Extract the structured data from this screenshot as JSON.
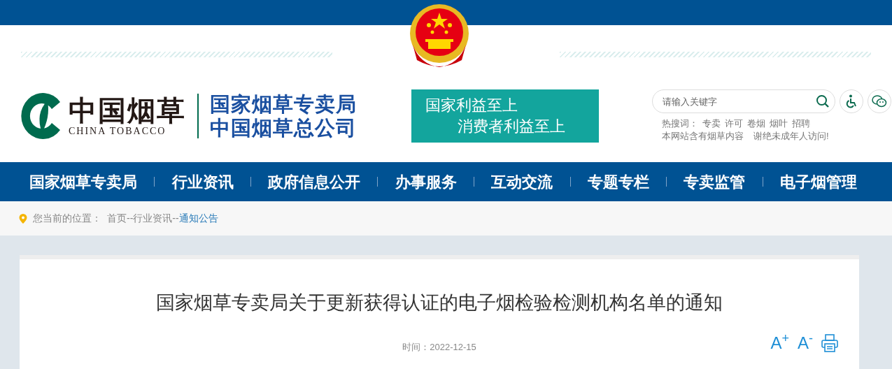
{
  "logo": {
    "name": "中国烟草",
    "subtitle": "CHINA TOBACCO"
  },
  "agency": [
    "国家烟草专卖局",
    "中国烟草总公司"
  ],
  "slogan": [
    "国家利益至上",
    "消费者利益至上"
  ],
  "search": {
    "placeholder": "请输入关键字"
  },
  "hot_words": {
    "label": "热搜词：",
    "items": [
      "专卖",
      "许可",
      "卷烟",
      "烟叶",
      "招聘"
    ]
  },
  "notice": [
    "本网站含有烟草内容",
    "谢绝未成年人访问!"
  ],
  "nav": [
    "国家烟草专卖局",
    "行业资讯",
    "政府信息公开",
    "办事服务",
    "互动交流",
    "专题专栏",
    "专卖监管",
    "电子烟管理"
  ],
  "breadcrumb": {
    "label": "您当前的位置：",
    "separator": "--",
    "items": [
      {
        "text": "首页",
        "current": false
      },
      {
        "text": "行业资讯",
        "current": false
      },
      {
        "text": "通知公告",
        "current": true
      }
    ]
  },
  "article": {
    "title": "国家烟草专卖局关于更新获得认证的电子烟检验检测机构名单的通知",
    "date": "时间：2022-12-15",
    "font_buttons": [
      "A$^{+}$",
      "A$^{-}$"
    ]
  }
}
